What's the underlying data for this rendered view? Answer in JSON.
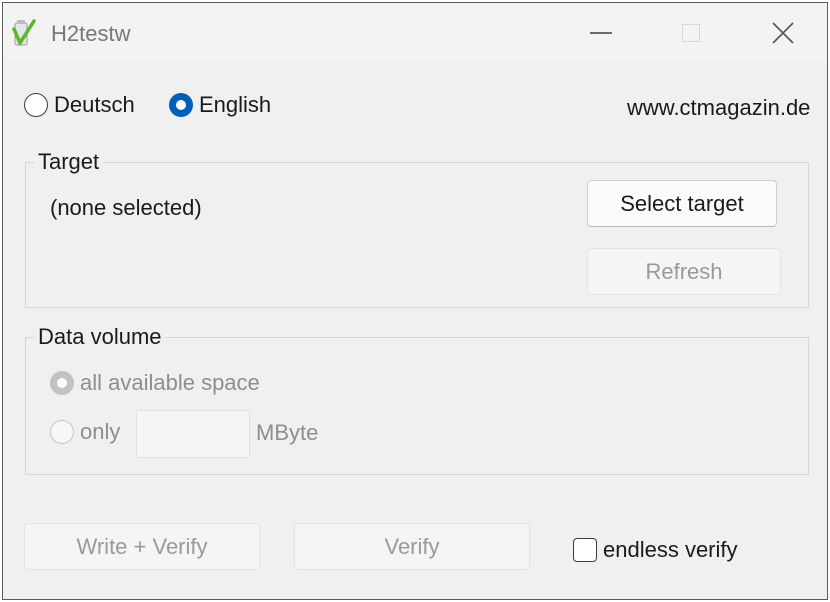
{
  "window": {
    "title": "H2testw",
    "controls": [
      "minimize",
      "maximize",
      "close"
    ]
  },
  "language": {
    "options": [
      {
        "label": "Deutsch",
        "selected": false
      },
      {
        "label": "English",
        "selected": true
      }
    ]
  },
  "website": "www.ctmagazin.de",
  "target": {
    "group_label": "Target",
    "value": "(none selected)",
    "select_label": "Select target",
    "refresh_label": "Refresh"
  },
  "data_volume": {
    "group_label": "Data volume",
    "all_label": "all available space",
    "only_label": "only",
    "only_value": "",
    "unit": "MByte"
  },
  "actions": {
    "write_verify_label": "Write + Verify",
    "verify_label": "Verify",
    "endless_label": "endless verify",
    "endless_checked": false
  },
  "colors": {
    "accent": "#005fb8",
    "icon_green": "#5cb82e"
  }
}
